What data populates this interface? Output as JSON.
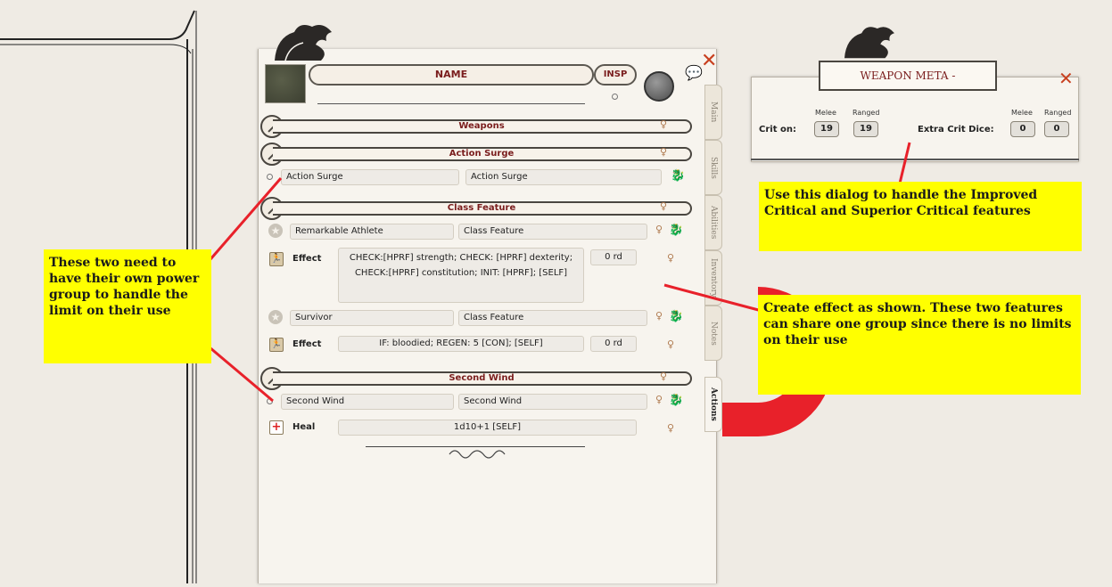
{
  "sheet": {
    "name_label": "NAME",
    "insp_label": "INSP",
    "tabs": [
      "Main",
      "Skills",
      "Abilities",
      "Inventory",
      "Notes",
      "Actions"
    ],
    "groups": {
      "weapons": "Weapons",
      "action_surge": "Action Surge",
      "class_feature": "Class Feature",
      "second_wind": "Second Wind"
    },
    "action_surge_row": {
      "name": "Action Surge",
      "group": "Action Surge"
    },
    "remarkable_row": {
      "name": "Remarkable Athlete",
      "group": "Class Feature"
    },
    "effect1": {
      "label": "Effect",
      "text": "CHECK:[HPRF] strength; CHECK: [HPRF] dexterity; CHECK:[HPRF] constitution; INIT: [HPRF]; [SELF]",
      "duration": "0 rd"
    },
    "survivor_row": {
      "name": "Survivor",
      "group": "Class Feature"
    },
    "effect2": {
      "label": "Effect",
      "text": "IF: bloodied; REGEN: 5 [CON]; [SELF]",
      "duration": "0 rd"
    },
    "second_wind_row": {
      "name": "Second Wind",
      "group": "Second Wind"
    },
    "heal": {
      "label": "Heal",
      "text": "1d10+1 [SELF]"
    }
  },
  "weapon_meta": {
    "title": "WEAPON META -",
    "crit_on_label": "Crit on:",
    "extra_crit_label": "Extra Crit Dice:",
    "melee_label": "Melee",
    "ranged_label": "Ranged",
    "crit_melee": "19",
    "crit_ranged": "19",
    "extra_melee": "0",
    "extra_ranged": "0"
  },
  "notes": {
    "left": "These two need to have their own power group to handle the limit on their use",
    "top_right": "Use this dialog to handle the Improved Critical and Superior Critical features",
    "mid_right": "Create effect as shown. These two features can share one group since there is no limits on their use"
  },
  "colors": {
    "accent_red": "#7a1d1d",
    "arrow_red": "#e8212a",
    "note_yellow": "#ffff00",
    "close_orange": "#c8401f"
  }
}
